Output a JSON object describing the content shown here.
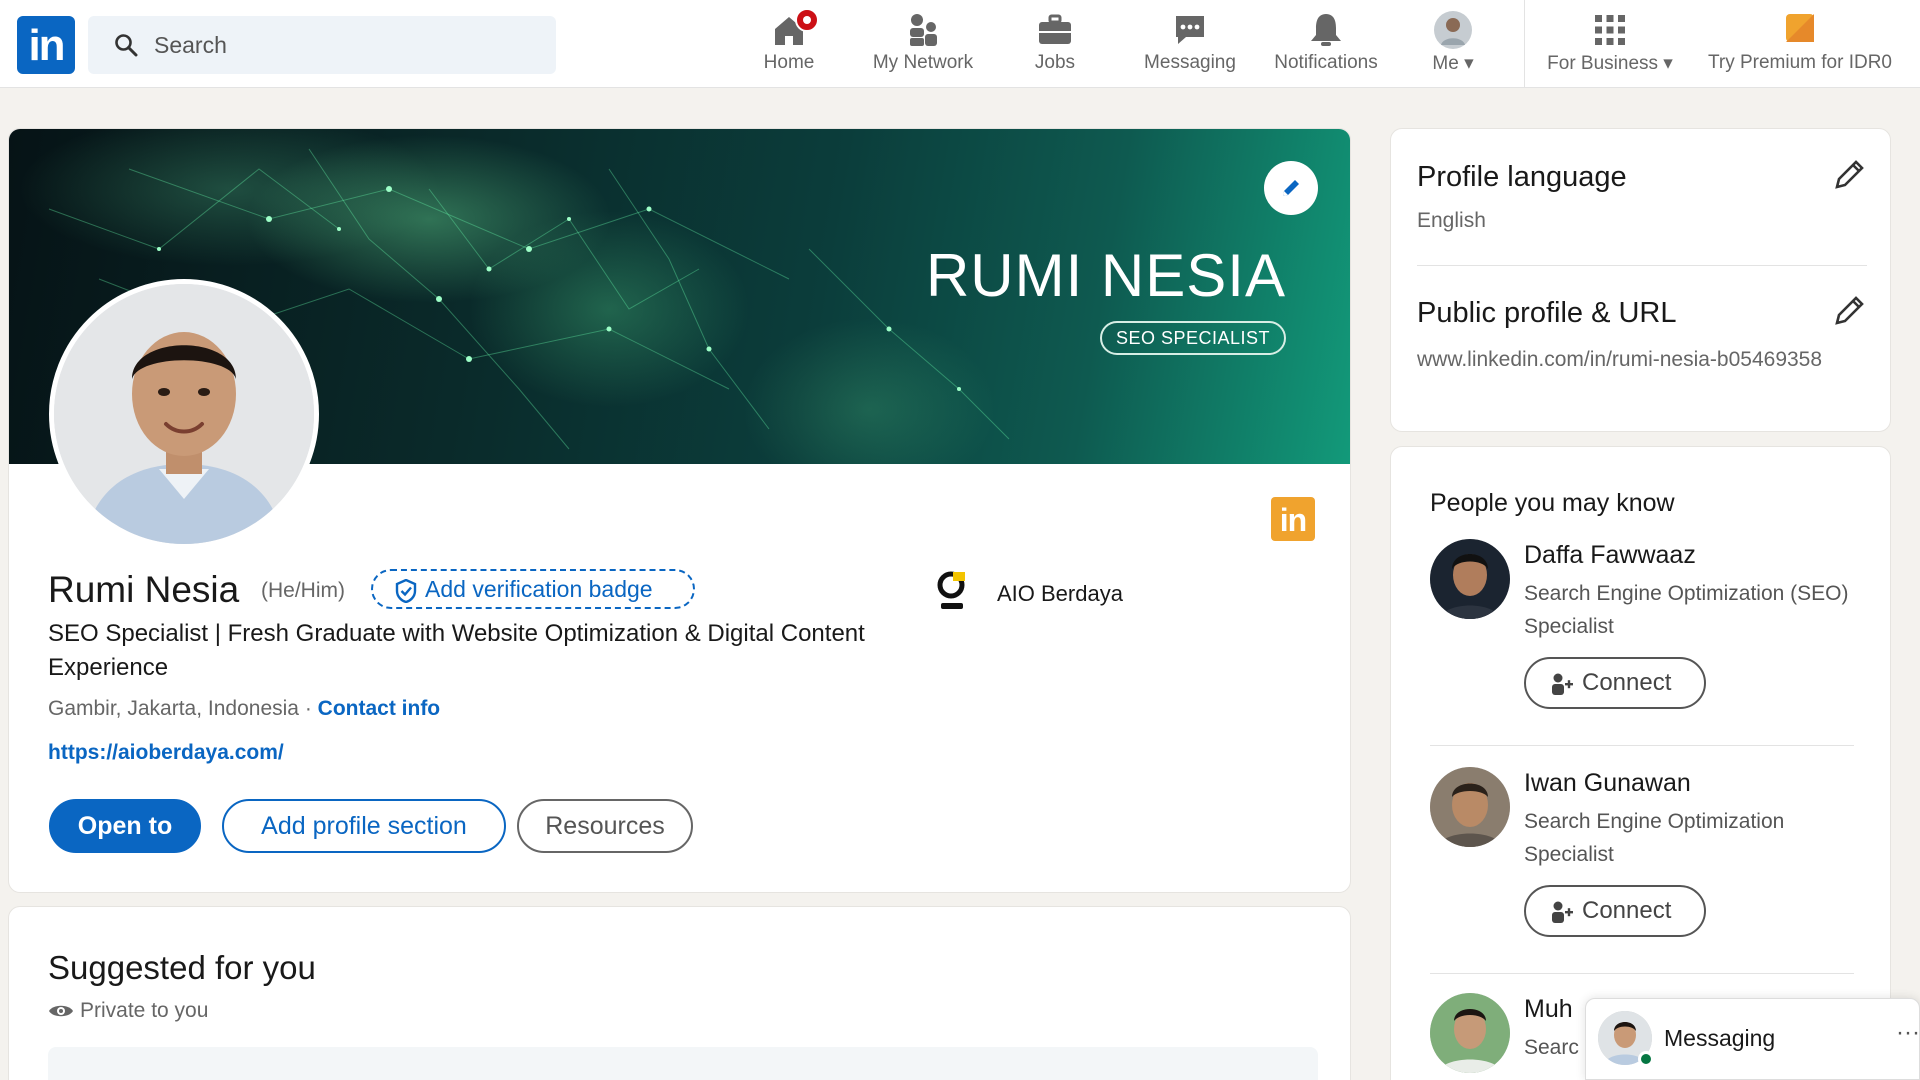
{
  "nav": {
    "search_placeholder": "Search",
    "items": [
      {
        "label": "Home",
        "icon": "home-icon"
      },
      {
        "label": "My Network",
        "icon": "network-icon"
      },
      {
        "label": "Jobs",
        "icon": "briefcase-icon"
      },
      {
        "label": "Messaging",
        "icon": "chat-icon"
      },
      {
        "label": "Notifications",
        "icon": "bell-icon"
      },
      {
        "label": "Me",
        "icon": "avatar"
      },
      {
        "label": "For Business",
        "icon": "grid-icon"
      },
      {
        "label": "Try Premium for IDR0",
        "icon": "premium-icon"
      }
    ]
  },
  "banner": {
    "title": "RUMI NESIA",
    "subtitle": "SEO SPECIALIST"
  },
  "profile": {
    "name": "Rumi Nesia",
    "pronouns": "(He/Him)",
    "verification_label": "Add verification badge",
    "headline": "SEO Specialist | Fresh Graduate with Website Optimization & Digital Content Experience",
    "location": "Gambir, Jakarta, Indonesia",
    "separator": "·",
    "contact_label": "Contact info",
    "website": "https://aioberdaya.com/",
    "company": "AIO Berdaya",
    "buttons": {
      "open_to": "Open to",
      "add_section": "Add profile section",
      "resources": "Resources"
    }
  },
  "suggested": {
    "title": "Suggested for you",
    "privacy": "Private to you"
  },
  "sidebar": {
    "language_title": "Profile language",
    "language_value": "English",
    "url_title": "Public profile & URL",
    "url_value": "www.linkedin.com/in/rumi-nesia-b05469358"
  },
  "pymk": {
    "title": "People you may know",
    "connect_label": "Connect",
    "people": [
      {
        "name": "Daffa Fawwaaz",
        "desc": "Search Engine Optimization (SEO) Specialist"
      },
      {
        "name": "Iwan Gunawan",
        "desc": "Search Engine Optimization Specialist"
      },
      {
        "name": "Muh",
        "desc": "Searc"
      }
    ]
  },
  "messaging": {
    "label": "Messaging",
    "more": "···"
  },
  "colors": {
    "brand": "#0a66c2",
    "premium": "#f0a32e",
    "notification": "#cc1016"
  }
}
